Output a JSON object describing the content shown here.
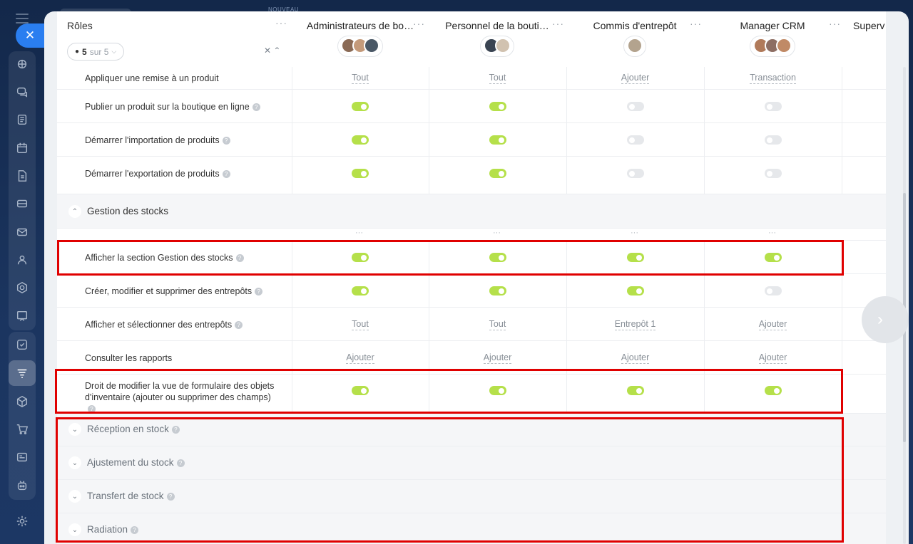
{
  "top": {
    "nouveau": "NOUVEAU"
  },
  "header": {
    "roles_title": "Rôles",
    "filter_count": "5",
    "filter_suffix": "sur 5",
    "columns": [
      {
        "title": "Administrateurs de bo…",
        "avatars": [
          "#8a6a55",
          "#c49a7a",
          "#4a5866"
        ]
      },
      {
        "title": "Personnel de la bouti…",
        "avatars": [
          "#3a4452",
          "#d1c2b0"
        ]
      },
      {
        "title": "Commis d'entrepôt",
        "avatars": [
          "#b3a38e"
        ]
      },
      {
        "title": "Manager CRM",
        "avatars": [
          "#b07a5a",
          "#8d6e63",
          "#c08a66"
        ]
      },
      {
        "title": "Superv"
      }
    ]
  },
  "rows": [
    {
      "label": "Appliquer une remise à un produit",
      "help": false,
      "type": "text",
      "values": [
        "Tout",
        "Tout",
        "Ajouter",
        "Transaction"
      ]
    },
    {
      "label": "Publier un produit sur la boutique en ligne",
      "help": true,
      "type": "toggle",
      "values": [
        true,
        true,
        false,
        false
      ]
    },
    {
      "label": "Démarrer l'importation de produits",
      "help": true,
      "type": "toggle",
      "values": [
        true,
        true,
        false,
        false
      ]
    },
    {
      "label": "Démarrer l'exportation de produits",
      "help": true,
      "type": "toggle",
      "values": [
        true,
        true,
        false,
        false
      ]
    }
  ],
  "section_stock": {
    "title": "Gestion des stocks"
  },
  "stock_rows": [
    {
      "label": "Afficher la section Gestion des stocks",
      "help": true,
      "type": "toggle",
      "values": [
        true,
        true,
        true,
        true
      ]
    },
    {
      "label": "Créer, modifier et supprimer des entrepôts",
      "help": true,
      "type": "toggle",
      "values": [
        true,
        true,
        true,
        false
      ]
    },
    {
      "label": "Afficher et sélectionner des entrepôts",
      "help": true,
      "type": "text",
      "values": [
        "Tout",
        "Tout",
        "Entrepôt 1",
        "Ajouter"
      ]
    },
    {
      "label": "Consulter les rapports",
      "help": false,
      "type": "text",
      "values": [
        "Ajouter",
        "Ajouter",
        "Ajouter",
        "Ajouter"
      ]
    },
    {
      "label": "Droit de modifier la vue de formulaire des objets d'inventaire (ajouter ou supprimer des champs)",
      "help": true,
      "type": "toggle",
      "values": [
        true,
        true,
        true,
        true
      ]
    }
  ],
  "collapsed_sections": [
    {
      "title": "Réception en stock"
    },
    {
      "title": "Ajustement du stock"
    },
    {
      "title": "Transfert de stock"
    },
    {
      "title": "Radiation"
    }
  ],
  "highlight_color": "#e00000",
  "toggle_on_color": "#b5e04a"
}
